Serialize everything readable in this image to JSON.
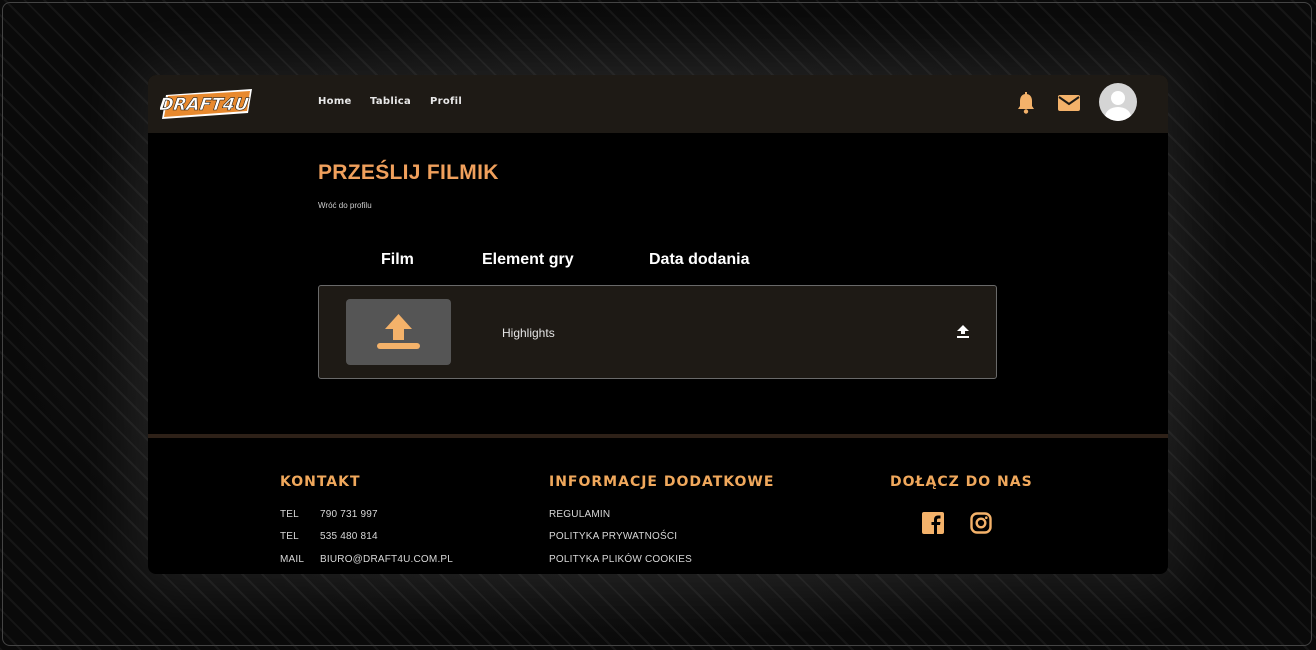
{
  "brand": {
    "logo_text": "DRAFT4U"
  },
  "nav": {
    "links": [
      "Home",
      "Tablica",
      "Profil"
    ]
  },
  "icons": {
    "notifications": "bell-icon",
    "messages": "envelope-icon",
    "avatar": "user-avatar",
    "upload": "upload-icon",
    "facebook": "facebook-icon",
    "instagram": "instagram-icon"
  },
  "colors": {
    "accent": "#f0a05c",
    "navbar_bg": "#1e1a15",
    "icon_orange": "#f4b26a"
  },
  "main": {
    "title": "PRZEŚLIJ FILMIK",
    "back_link": "Wróć do profilu",
    "columns": [
      "Film",
      "Element gry",
      "Data dodania"
    ],
    "row": {
      "element": "Highlights"
    }
  },
  "footer": {
    "contact": {
      "heading": "KONTAKT",
      "items": [
        {
          "label": "TEL",
          "value": "790 731 997"
        },
        {
          "label": "TEL",
          "value": "535 480 814"
        },
        {
          "label": "MAIL",
          "value": "BIURO@DRAFT4U.COM.PL"
        }
      ]
    },
    "info": {
      "heading": "INFORMACJE DODATKOWE",
      "links": [
        "REGULAMIN",
        "POLITYKA PRYWATNOŚCI",
        "POLITYKA PLIKÓW COOKIES"
      ]
    },
    "social": {
      "heading": "DOŁĄCZ DO NAS"
    }
  }
}
